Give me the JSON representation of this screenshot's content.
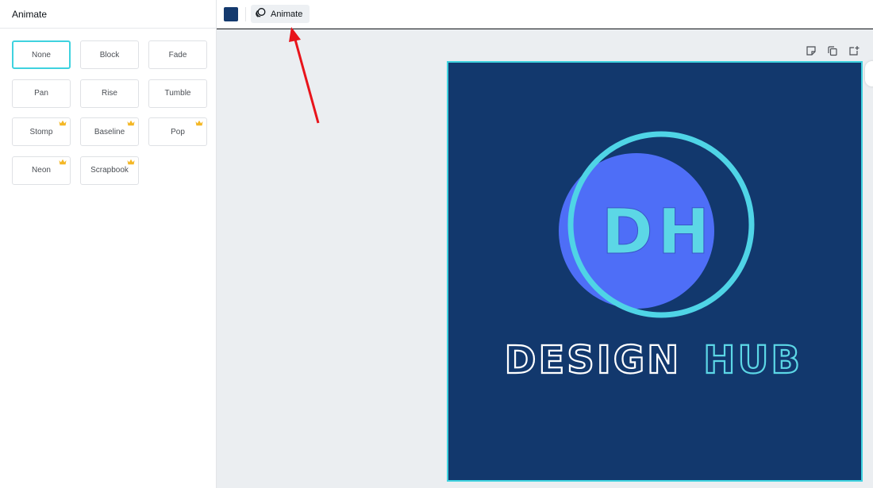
{
  "panel": {
    "title": "Animate",
    "animations": [
      {
        "label": "None",
        "selected": true,
        "premium": false
      },
      {
        "label": "Block",
        "selected": false,
        "premium": false
      },
      {
        "label": "Fade",
        "selected": false,
        "premium": false
      },
      {
        "label": "Pan",
        "selected": false,
        "premium": false
      },
      {
        "label": "Rise",
        "selected": false,
        "premium": false
      },
      {
        "label": "Tumble",
        "selected": false,
        "premium": false
      },
      {
        "label": "Stomp",
        "selected": false,
        "premium": true
      },
      {
        "label": "Baseline",
        "selected": false,
        "premium": true
      },
      {
        "label": "Pop",
        "selected": false,
        "premium": true
      },
      {
        "label": "Neon",
        "selected": false,
        "premium": true
      },
      {
        "label": "Scrapbook",
        "selected": false,
        "premium": true
      }
    ]
  },
  "toolbar": {
    "color": "#143a6e",
    "animate_label": "Animate"
  },
  "page_tools": [
    "notes-icon",
    "duplicate-page-icon",
    "add-page-icon"
  ],
  "design": {
    "initials": "DH",
    "word1": "DESIGN",
    "word2": "HUB",
    "background": "#12386d",
    "circle_fill": "#4e6ef7",
    "ring_color": "#4fd4e6",
    "accent": "#5cd7e6",
    "outline_white": "#ffffff"
  },
  "annotation": {
    "arrow_color": "#e8141b"
  }
}
